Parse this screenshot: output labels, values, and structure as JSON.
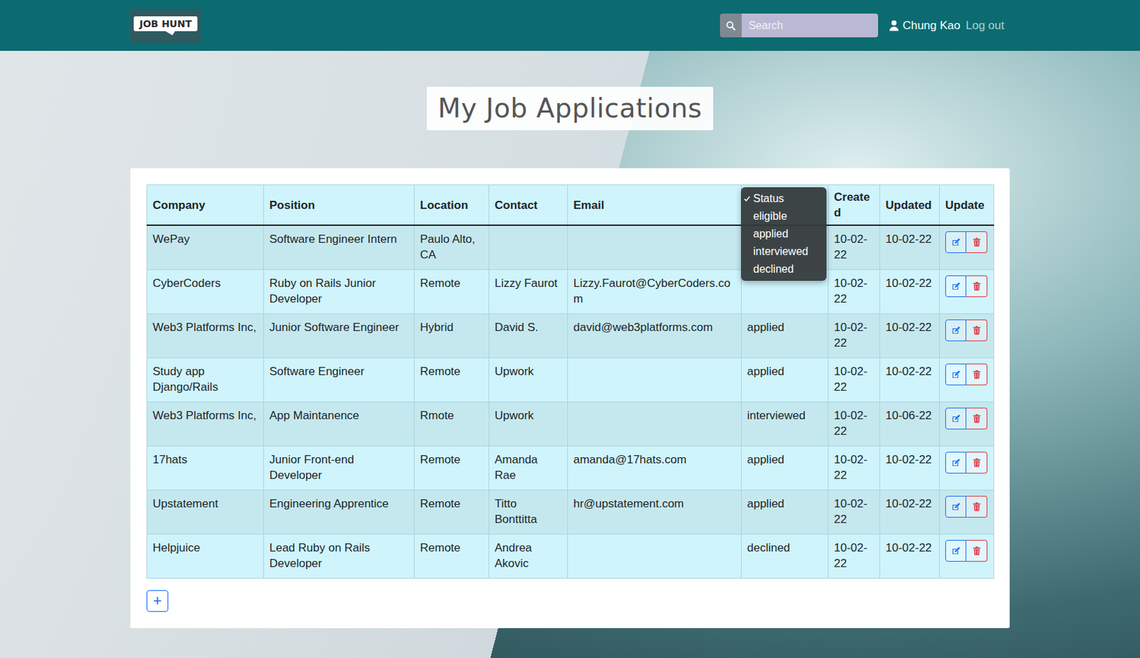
{
  "header": {
    "logo": "JOB HUNT",
    "search": {
      "placeholder": "Search"
    },
    "user": "Chung Kao",
    "logout": "Log out"
  },
  "page": {
    "title": "My Job Applications"
  },
  "table": {
    "columns": [
      {
        "kind": "text",
        "label": "Company"
      },
      {
        "kind": "text",
        "label": "Position"
      },
      {
        "kind": "text",
        "label": "Location"
      },
      {
        "kind": "text",
        "label": "Contact"
      },
      {
        "kind": "text",
        "label": "Email"
      },
      {
        "kind": "dropdown",
        "options": [
          {
            "label": "Status",
            "selected": true
          },
          {
            "label": "eligible",
            "selected": false
          },
          {
            "label": "applied",
            "selected": false
          },
          {
            "label": "interviewed",
            "selected": false
          },
          {
            "label": "declined",
            "selected": false
          }
        ]
      },
      {
        "kind": "text",
        "label": "Created"
      },
      {
        "kind": "text",
        "label": "Updated"
      },
      {
        "kind": "text",
        "label": "Update"
      }
    ],
    "rows": [
      [
        "WePay",
        "Software Engineer Intern",
        "Paulo Alto, CA",
        "",
        "",
        "",
        "10-02-22",
        "10-02-22"
      ],
      [
        "CyberCoders",
        "Ruby on Rails Junior Developer",
        "Remote",
        "Lizzy Faurot",
        "Lizzy.Faurot@CyberCoders.com",
        "",
        "10-02-22",
        "10-02-22"
      ],
      [
        "Web3 Platforms Inc,",
        "Junior Software Engineer",
        "Hybrid",
        "David S.",
        "david@web3platforms.com",
        "applied",
        "10-02-22",
        "10-02-22"
      ],
      [
        "Study app Django/Rails",
        "Software Engineer",
        "Remote",
        "Upwork",
        "",
        "applied",
        "10-02-22",
        "10-02-22"
      ],
      [
        "Web3 Platforms Inc,",
        "App Maintanence",
        "Rmote",
        "Upwork",
        "",
        "interviewed",
        "10-02-22",
        "10-06-22"
      ],
      [
        "17hats",
        "Junior Front-end Developer",
        "Remote",
        "Amanda Rae",
        "amanda@17hats.com",
        "applied",
        "10-02-22",
        "10-02-22"
      ],
      [
        "Upstatement",
        "Engineering Apprentice",
        "Remote",
        "Titto Bonttitta",
        "hr@upstatement.com",
        "applied",
        "10-02-22",
        "10-02-22"
      ],
      [
        "Helpjuice",
        "Lead Ruby on Rails Developer",
        "Remote",
        "Andrea Akovic",
        "",
        "declined",
        "10-02-22",
        "10-02-22"
      ]
    ]
  },
  "add_button": "+"
}
